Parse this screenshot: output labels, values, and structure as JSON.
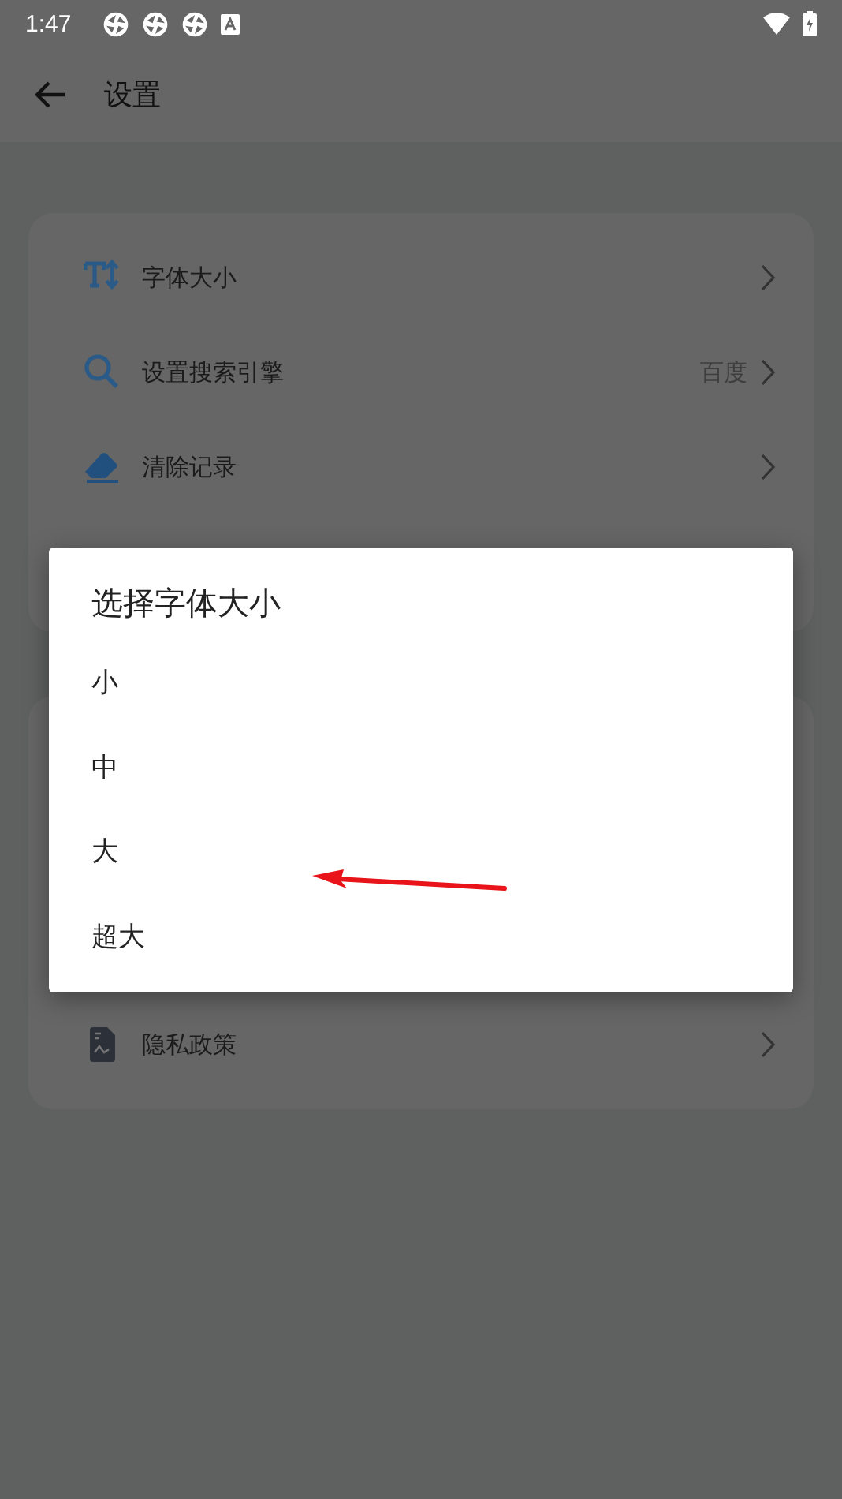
{
  "status_bar": {
    "time": "1:47"
  },
  "app_bar": {
    "title": "设置"
  },
  "settings_groups": [
    {
      "items": [
        {
          "label": "字体大小"
        },
        {
          "label": "设置搜索引擎",
          "value": "百度"
        },
        {
          "label": "清除记录"
        }
      ]
    },
    {
      "items": [
        {
          "label": "隐私政策"
        }
      ]
    }
  ],
  "dialog": {
    "title": "选择字体大小",
    "options": [
      "小",
      "中",
      "大",
      "超大"
    ]
  }
}
